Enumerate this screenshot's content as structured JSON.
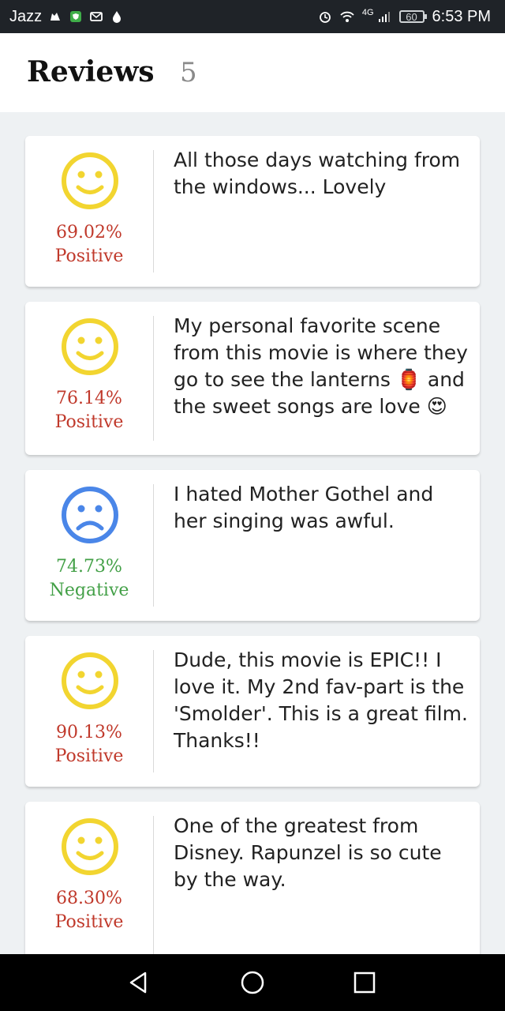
{
  "status_bar": {
    "carrier": "Jazz",
    "network": "4G",
    "battery": "60",
    "time": "6:53 PM"
  },
  "header": {
    "title": "Reviews",
    "count": "5"
  },
  "colors": {
    "positive": "#c0392b",
    "negative": "#43a047",
    "happy_face": "#f2d530",
    "sad_face": "#4a86e8"
  },
  "reviews": [
    {
      "sentiment_icon": "happy-face-icon",
      "percent": "69.02%",
      "label": "Positive",
      "text": "All those days watching from the windows... Lovely"
    },
    {
      "sentiment_icon": "happy-face-icon",
      "percent": "76.14%",
      "label": "Positive",
      "text": "My personal favorite scene from this movie is where they go to see the lanterns 🏮 and the sweet songs are love 😍"
    },
    {
      "sentiment_icon": "sad-face-icon",
      "percent": "74.73%",
      "label": "Negative",
      "text": "I hated Mother Gothel and her singing was awful."
    },
    {
      "sentiment_icon": "happy-face-icon",
      "percent": "90.13%",
      "label": "Positive",
      "text": "Dude, this movie is EPIC!! I love it. My 2nd fav-part is the 'Smolder'. This is a great film. Thanks!!"
    },
    {
      "sentiment_icon": "happy-face-icon",
      "percent": "68.30%",
      "label": "Positive",
      "text": "One of the greatest from Disney. Rapunzel is so cute by the way."
    }
  ]
}
